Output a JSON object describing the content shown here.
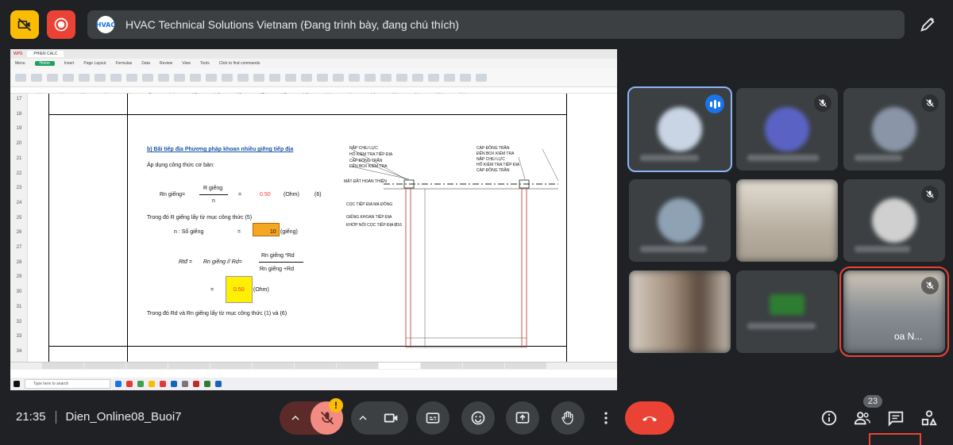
{
  "header": {
    "title": "HVAC Technical Solutions Vietnam (Đang trình bày, đang chú thích)",
    "presenter_logo": "HVAC",
    "icons": {
      "camera_off": "camera-off-icon",
      "record": "record-icon",
      "annotate": "pen-annotate-icon"
    }
  },
  "presentation": {
    "app_tab": "PHIEN CALC",
    "menu": [
      "Menu",
      "Home",
      "Insert",
      "Page Layout",
      "Formulas",
      "Data",
      "Review",
      "View",
      "Tools",
      "Click to find commands"
    ],
    "columns": [
      "U",
      "V",
      "W",
      "X",
      "Y",
      "Z",
      "AA",
      "AB",
      "AC",
      "AD",
      "AE",
      "AF",
      "AG",
      "AH",
      "AI",
      "AJ",
      "AK",
      "AL",
      "AM",
      "AN"
    ],
    "rows": [
      "17",
      "18",
      "19",
      "20",
      "21",
      "22",
      "23",
      "24",
      "25",
      "26",
      "27",
      "28",
      "29",
      "30",
      "31",
      "32",
      "33",
      "34"
    ],
    "content": {
      "section_title": "b) Bãi tiếp địa Phương pháp khoan nhiều giếng tiếp địa",
      "intro": "Áp dụng công thức cơ bản:",
      "rn_label": "Rn giếng=",
      "rn_numerator": "R giếng",
      "rn_denominator": "n",
      "rn_equals": "=",
      "rn_value": "0.50",
      "rn_unit": "(Ohm)",
      "rn_ref": "(6)",
      "trong_do_1": "Trong đó R giếng  lấy từ mục công thức (5)",
      "n_label": "n : Số giếng",
      "n_equals": "=",
      "n_value": "10",
      "n_unit": "(giếng)",
      "rtd_label": "Rtđ =",
      "rtd_expr": "Rn giếng // Rd=",
      "rtd_num": "Rn giếng *Rd",
      "rtd_den": "Rn giếng +Rd",
      "rtd_equals": "=",
      "rtd_value": "0.50",
      "rtd_unit": "(Ohm)",
      "trong_do_2": "Trong đó Rd và Rn giếng lấy từ mục công thức (1) và (6)"
    },
    "diagram_labels": [
      "NẮP CHỊU LỰC",
      "HỐ KIỂM TRA TIẾP ĐỊA",
      "CÁP ĐỒNG TRẦN",
      "ĐẾN BOX KIỂM TRA",
      "MẶT ĐẤT HOÀN THIỆN",
      "CỌC TIẾP ĐỊA MẠ ĐỒNG",
      "GIẾNG KHOAN TIẾP ĐỊA",
      "KHỚP NỐI CỌC TIẾP ĐỊA Ø16"
    ],
    "diagram_labels_right": [
      "CÁP ĐỒNG TRẦN",
      "ĐẾN BOX KIỂM TRA",
      "NẮP CHỊU LỰC",
      "HỐ KIỂM TRA TIẾP ĐỊA",
      "CÁP ĐỒNG TRẦN"
    ],
    "taskbar_search": "Type here to search"
  },
  "participants": [
    {
      "id": "p1",
      "state": "speaking",
      "avatar_color": "#c9d4e4"
    },
    {
      "id": "p2",
      "state": "muted",
      "avatar_color": "#5a63c4"
    },
    {
      "id": "p3",
      "state": "muted",
      "avatar_color": "#8a96a8"
    },
    {
      "id": "p4",
      "state": "none",
      "avatar_color": "#8ea2b4"
    },
    {
      "id": "p5",
      "state": "video",
      "avatar_color": "#b9b2a6"
    },
    {
      "id": "p6",
      "state": "muted",
      "avatar_color": "#d0d0d0"
    },
    {
      "id": "p7",
      "state": "video",
      "avatar_color": "#7a6a5a"
    },
    {
      "id": "p8",
      "state": "none",
      "avatar_color": "#2e7d32"
    },
    {
      "id": "p9",
      "state": "muted-video",
      "avatar_color": "#6a7a8a",
      "name": "oa N..."
    }
  ],
  "footer": {
    "time": "21:35",
    "meeting_name": "Dien_Online08_Buoi7",
    "warning": "!",
    "participant_count": "23",
    "icons": {
      "mic": "mic-off-icon",
      "chevron_mic": "chevron-up-icon",
      "chevron_cam": "chevron-up-icon",
      "camera": "camera-icon",
      "captions": "captions-icon",
      "emoji": "emoji-icon",
      "present": "present-icon",
      "hand": "raise-hand-icon",
      "more": "more-vert-icon",
      "hangup": "hangup-icon",
      "info": "info-icon",
      "people": "people-icon",
      "chat": "chat-icon",
      "activities": "activities-icon"
    }
  }
}
